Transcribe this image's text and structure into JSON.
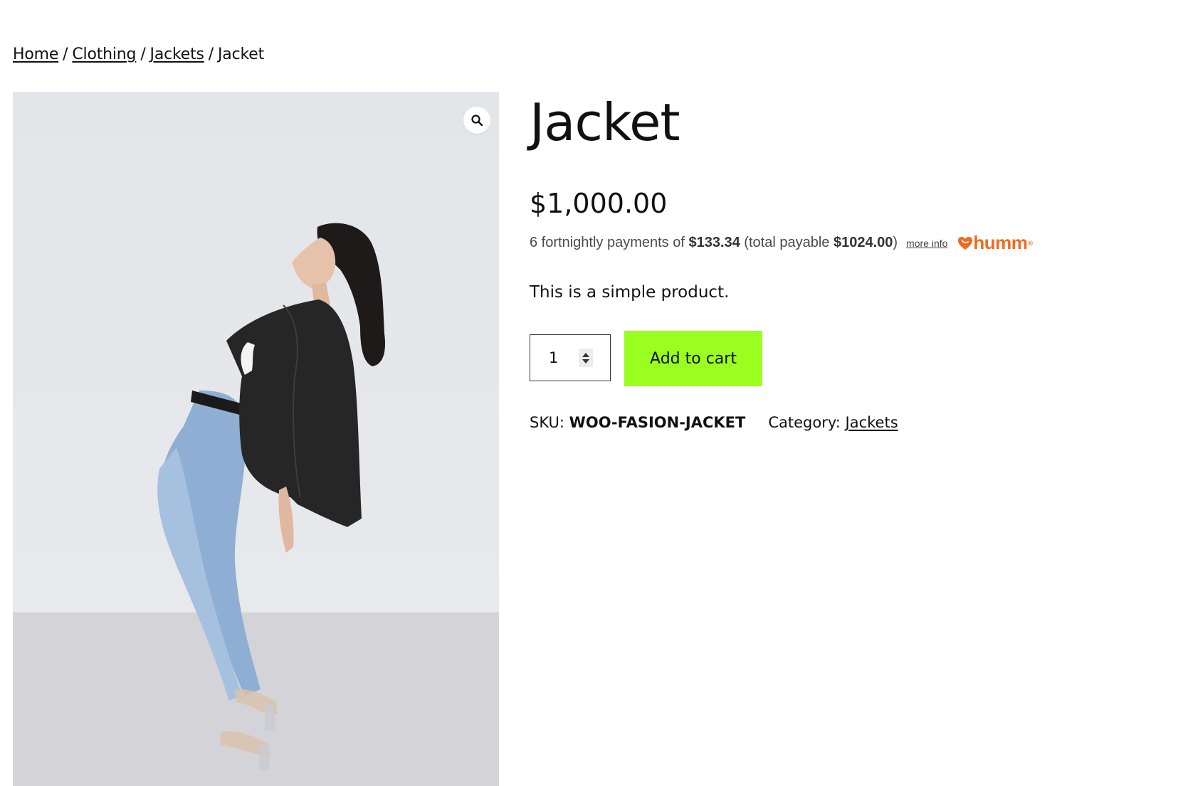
{
  "breadcrumb": {
    "home": "Home",
    "clothing": "Clothing",
    "jackets": "Jackets",
    "current": "Jacket",
    "separator": "/"
  },
  "gallery": {
    "zoom_icon": "magnifier-icon"
  },
  "product": {
    "title": "Jacket",
    "price": "$1,000.00",
    "description": "This is a simple product.",
    "quantity": "1",
    "add_to_cart_label": "Add to cart",
    "sku_label": "SKU:",
    "sku_value": "WOO-FASION-JACKET",
    "category_label": "Category:",
    "category_value": "Jackets"
  },
  "humm": {
    "prefix": "6 fortnightly payments of ",
    "installment": "$133.34",
    "mid": " (total payable ",
    "total": "$1024.00",
    "suffix": ")",
    "more_info": "more info",
    "logo_text": "humm",
    "logo_mark": "®",
    "brand_color": "#f26b1d"
  },
  "colors": {
    "cart_button": "#9aff1f",
    "text": "#111111"
  }
}
